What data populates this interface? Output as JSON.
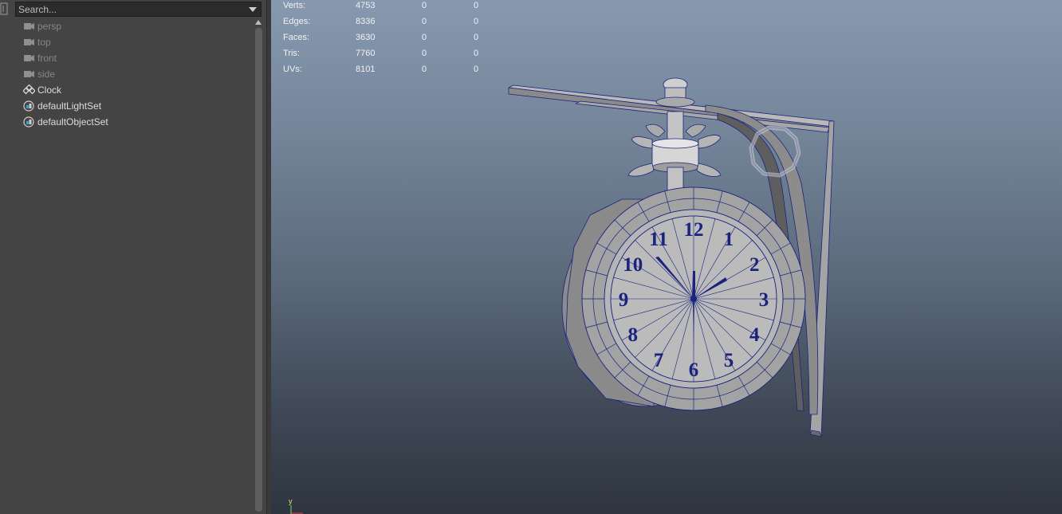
{
  "outliner": {
    "search": {
      "placeholder": "Search...",
      "value": ""
    },
    "items": [
      {
        "label": "persp",
        "icon": "camera-icon",
        "dim": true
      },
      {
        "label": "top",
        "icon": "camera-icon",
        "dim": true
      },
      {
        "label": "front",
        "icon": "camera-icon",
        "dim": true
      },
      {
        "label": "side",
        "icon": "camera-icon",
        "dim": true
      },
      {
        "label": "Clock",
        "icon": "group-icon",
        "dim": false
      },
      {
        "label": "defaultLightSet",
        "icon": "set-icon",
        "dim": false
      },
      {
        "label": "defaultObjectSet",
        "icon": "set-icon",
        "dim": false
      }
    ]
  },
  "viewport": {
    "hud": [
      {
        "label": "Verts:",
        "values": [
          "4753",
          "0",
          "0"
        ]
      },
      {
        "label": "Edges:",
        "values": [
          "8336",
          "0",
          "0"
        ]
      },
      {
        "label": "Faces:",
        "values": [
          "3630",
          "0",
          "0"
        ]
      },
      {
        "label": "Tris:",
        "values": [
          "7760",
          "0",
          "0"
        ]
      },
      {
        "label": "UVs:",
        "values": [
          "8101",
          "0",
          "0"
        ]
      }
    ],
    "clock_numerals": [
      "12",
      "1",
      "2",
      "3",
      "4",
      "5",
      "6",
      "7",
      "8",
      "9",
      "10",
      "11"
    ],
    "axis": {
      "y_label": "y"
    },
    "colors": {
      "wire": "#1a237e",
      "mesh": "#9a9a9a",
      "background_top": "#8799af",
      "background_bottom": "#2e3540"
    }
  }
}
